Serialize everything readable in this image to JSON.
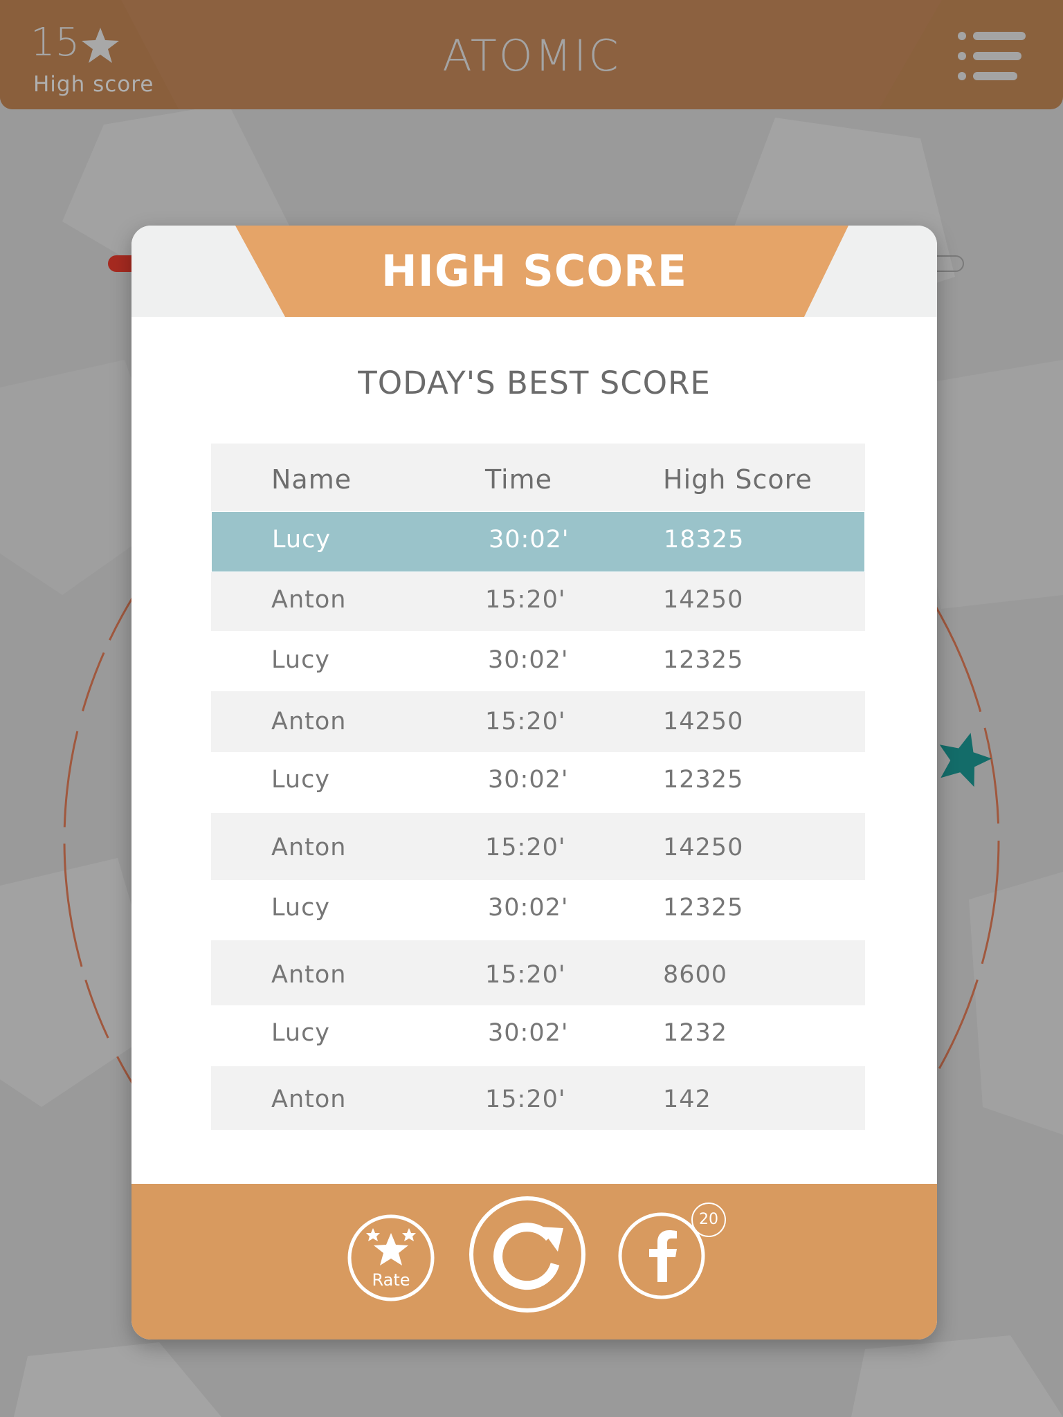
{
  "header": {
    "score_value": "15",
    "score_label": "High score",
    "title": "ATOMIC",
    "star_icon": "star-icon",
    "menu_icon": "list-menu-icon"
  },
  "modal": {
    "title": "HIGH SCORE",
    "subtitle": "TODAY'S BEST SCORE",
    "columns": [
      "Name",
      "Time",
      "High Score"
    ],
    "rows": [
      {
        "name": "Lucy",
        "time": "30:02'",
        "score": "18325",
        "highlighted": true
      },
      {
        "name": "Anton",
        "time": "15:20'",
        "score": "14250",
        "highlighted": false
      },
      {
        "name": "Lucy",
        "time": "30:02'",
        "score": "12325",
        "highlighted": false
      },
      {
        "name": "Anton",
        "time": "15:20'",
        "score": "14250",
        "highlighted": false
      },
      {
        "name": "Lucy",
        "time": "30:02'",
        "score": "12325",
        "highlighted": false
      },
      {
        "name": "Anton",
        "time": "15:20'",
        "score": "14250",
        "highlighted": false
      },
      {
        "name": "Lucy",
        "time": "30:02'",
        "score": "12325",
        "highlighted": false
      },
      {
        "name": "Anton",
        "time": "15:20'",
        "score": "8600",
        "highlighted": false
      },
      {
        "name": "Lucy",
        "time": "30:02'",
        "score": "1232",
        "highlighted": false
      },
      {
        "name": "Anton",
        "time": "15:20'",
        "score": "142",
        "highlighted": false
      }
    ]
  },
  "footer": {
    "rate_label": "Rate",
    "rate_icon": "rate-stars-icon",
    "replay_icon": "replay-icon",
    "facebook_icon": "facebook-icon",
    "facebook_badge": "20"
  },
  "colors": {
    "header_bar": "#8a613d",
    "title_tab": "#e5a468",
    "footer": "#d89a5f",
    "highlight_row": "#9ac3ca",
    "teal_star": "#136c69",
    "ring": "#a0583e"
  }
}
